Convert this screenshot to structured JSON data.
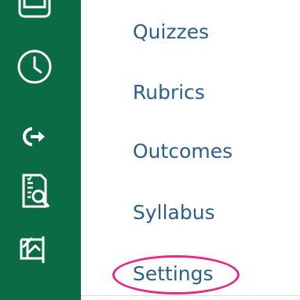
{
  "rail": {
    "icons": [
      {
        "name": "inbox-icon"
      },
      {
        "name": "clock-icon"
      },
      {
        "name": "logout-icon"
      },
      {
        "name": "document-search-icon"
      },
      {
        "name": "image-frame-icon"
      }
    ],
    "background": "#0b6b47"
  },
  "nav": {
    "items": [
      {
        "label": "Quizzes"
      },
      {
        "label": "Rubrics"
      },
      {
        "label": "Outcomes"
      },
      {
        "label": "Syllabus"
      },
      {
        "label": "Settings"
      }
    ],
    "link_color": "#2a5f8b"
  },
  "annotation": {
    "color": "#e8278a"
  }
}
